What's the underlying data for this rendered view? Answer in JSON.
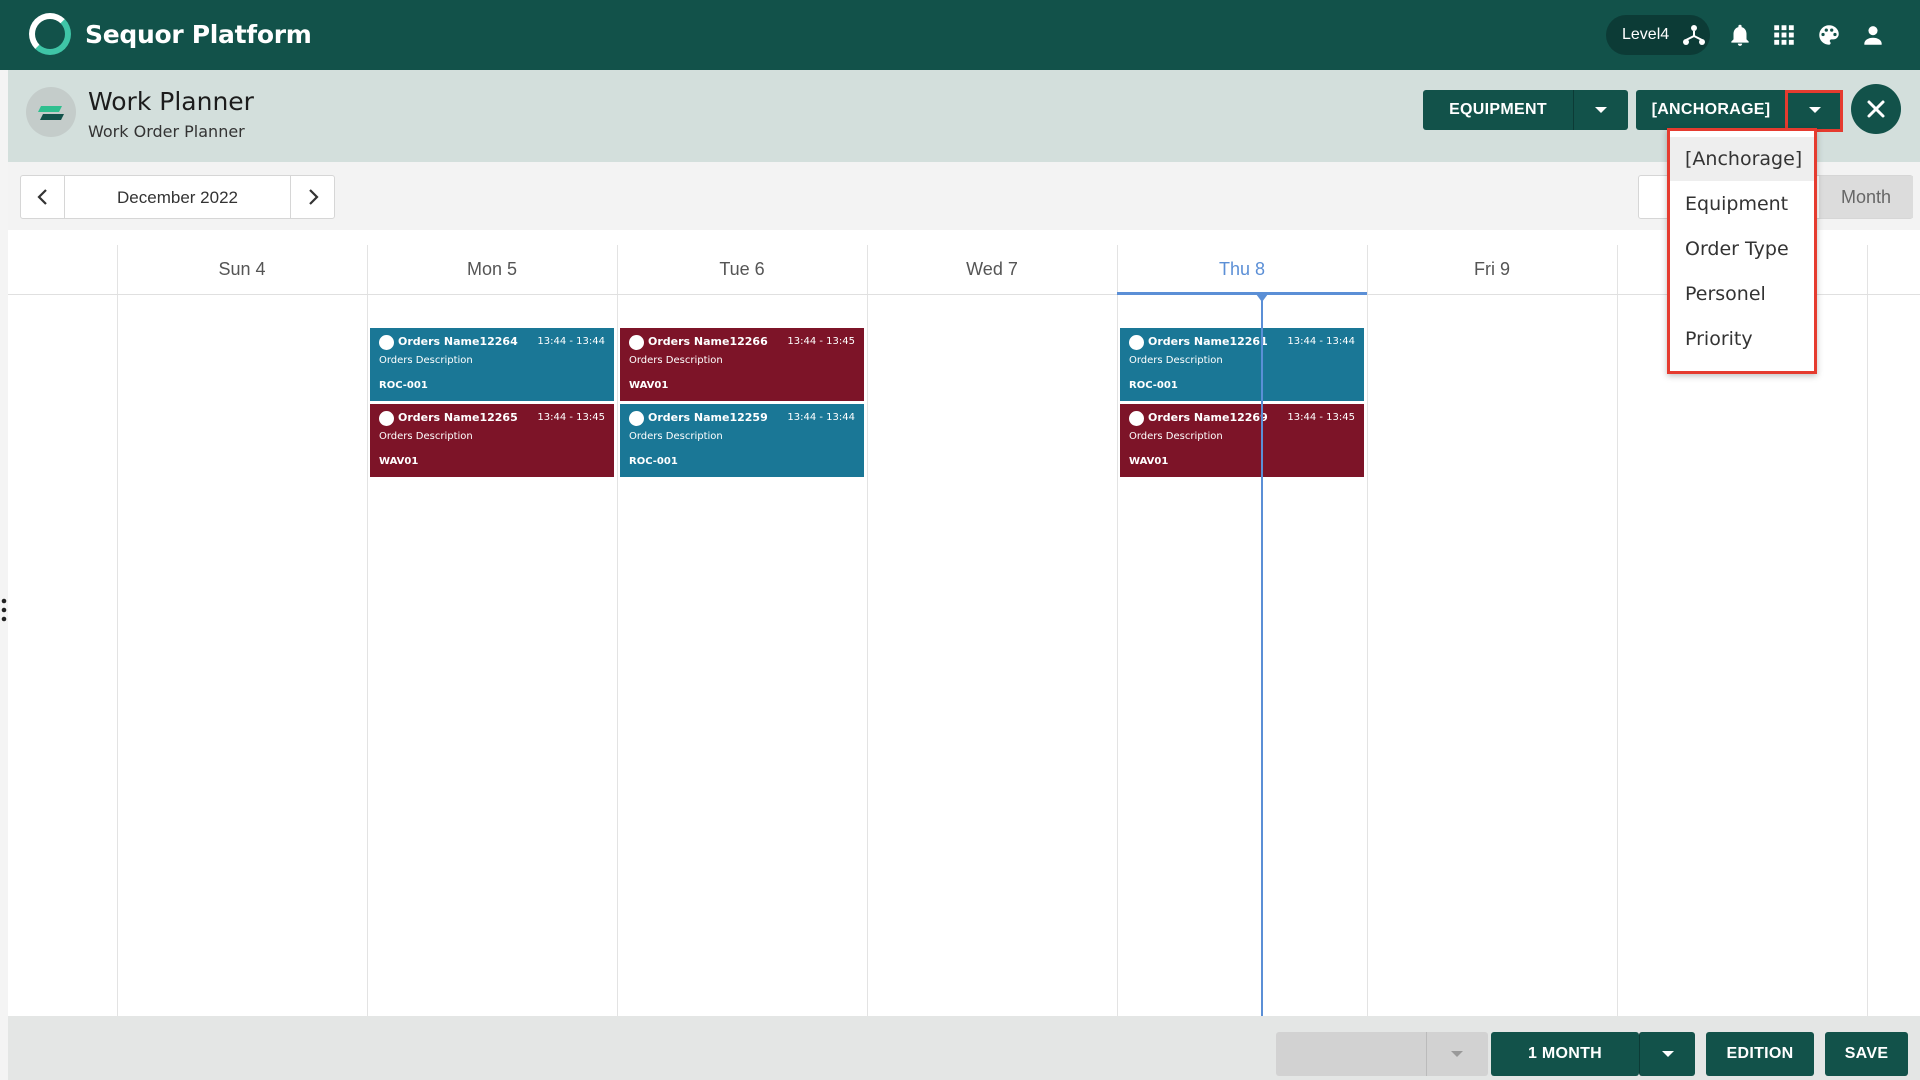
{
  "app": {
    "brand": "Sequor Platform",
    "level": "Level4"
  },
  "header": {
    "title": "Work Planner",
    "subtitle": "Work Order Planner"
  },
  "toolbar": {
    "group_by_label": "EQUIPMENT",
    "filter_label": "[ANCHORAGE]"
  },
  "date_nav": {
    "label": "December 2022"
  },
  "view_switch": {
    "month_label": "Month"
  },
  "calendar": {
    "days": [
      {
        "label": "Sun 4"
      },
      {
        "label": "Mon 5"
      },
      {
        "label": "Tue 6"
      },
      {
        "label": "Wed 7"
      },
      {
        "label": "Thu 8"
      },
      {
        "label": "Fri 9"
      }
    ],
    "events": [
      {
        "name": "Orders Name12264",
        "time": "13:44 - 13:44",
        "desc": "Orders Description",
        "code": "ROC-001"
      },
      {
        "name": "Orders Name12265",
        "time": "13:44 - 13:45",
        "desc": "Orders Description",
        "code": "WAV01"
      },
      {
        "name": "Orders Name12266",
        "time": "13:44 - 13:45",
        "desc": "Orders Description",
        "code": "WAV01"
      },
      {
        "name": "Orders Name12259",
        "time": "13:44 - 13:44",
        "desc": "Orders Description",
        "code": "ROC-001"
      },
      {
        "name": "Orders Name12261",
        "time": "13:44 - 13:44",
        "desc": "Orders Description",
        "code": "ROC-001"
      },
      {
        "name": "Orders Name12269",
        "time": "13:44 - 13:45",
        "desc": "Orders Description",
        "code": "WAV01"
      }
    ]
  },
  "dropdown": {
    "items": [
      {
        "label": "[Anchorage]"
      },
      {
        "label": "Equipment"
      },
      {
        "label": "Order Type"
      },
      {
        "label": "Personel"
      },
      {
        "label": "Priority"
      }
    ]
  },
  "footer": {
    "period_label": "1 MONTH",
    "edition_label": "EDITION",
    "save_label": "SAVE"
  },
  "colors": {
    "primary": "#12524a",
    "event_blue": "#1a7796",
    "event_red": "#7d1428",
    "today": "#5b8fd6",
    "highlight": "#e53b2f"
  }
}
